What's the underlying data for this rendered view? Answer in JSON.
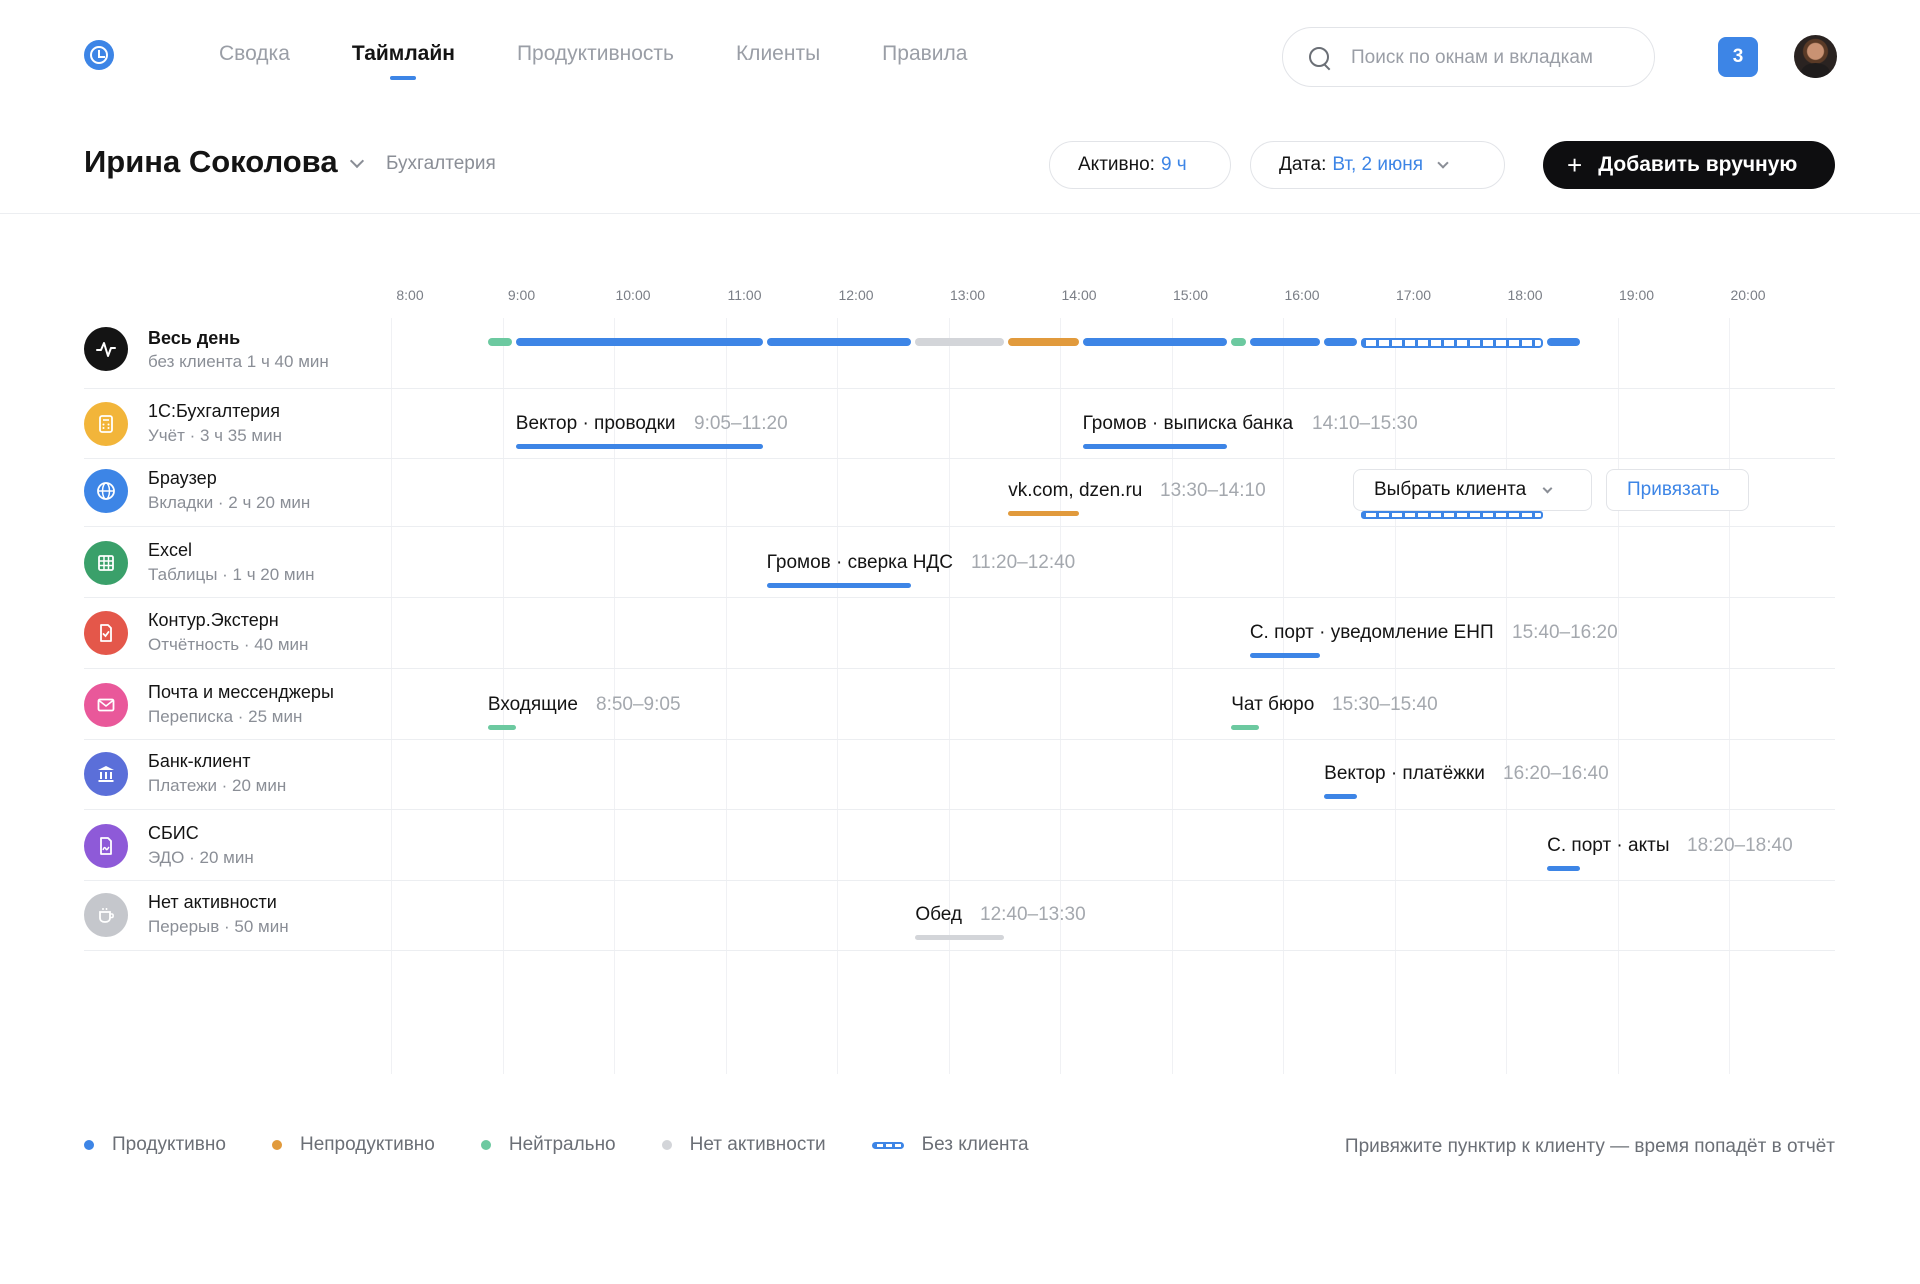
{
  "nav": {
    "items": [
      {
        "label": "Сводка",
        "active": false
      },
      {
        "label": "Таймлайн",
        "active": true
      },
      {
        "label": "Продуктивность",
        "active": false
      },
      {
        "label": "Клиенты",
        "active": false
      },
      {
        "label": "Правила",
        "active": false
      }
    ],
    "search_placeholder": "Поиск по окнам и вкладкам",
    "notifications": "3"
  },
  "header": {
    "person": "Ирина Соколова",
    "department": "Бухгалтерия",
    "active_label": "Активно:",
    "active_value": "9 ч",
    "date_label": "Дата:",
    "date_value": "Вт, 2 июня",
    "add_button": "Добавить вручную",
    "add_icon": "+"
  },
  "hours": [
    "8:00",
    "9:00",
    "10:00",
    "11:00",
    "12:00",
    "13:00",
    "14:00",
    "15:00",
    "16:00",
    "17:00",
    "18:00",
    "19:00",
    "20:00"
  ],
  "colors": {
    "productive": "#3d85e6",
    "unproductive": "#e19a3c",
    "neutral": "#6cc9a0",
    "idle": "#d3d5d9"
  },
  "summary_row": {
    "title": "Весь день",
    "subtitle": "без клиента 1 ч 40 мин",
    "icon": "pulse-icon",
    "segments": [
      {
        "start": "8:50",
        "end": "9:05",
        "type": "neutral"
      },
      {
        "start": "9:05",
        "end": "11:20",
        "type": "productive"
      },
      {
        "start": "11:20",
        "end": "12:40",
        "type": "productive"
      },
      {
        "start": "12:40",
        "end": "13:30",
        "type": "idle"
      },
      {
        "start": "13:30",
        "end": "14:10",
        "type": "unproductive"
      },
      {
        "start": "14:10",
        "end": "15:30",
        "type": "productive"
      },
      {
        "start": "15:30",
        "end": "15:40",
        "type": "neutral"
      },
      {
        "start": "15:40",
        "end": "16:20",
        "type": "productive"
      },
      {
        "start": "16:20",
        "end": "16:40",
        "type": "productive"
      },
      {
        "start": "16:40",
        "end": "18:20",
        "type": "no-client"
      },
      {
        "start": "18:20",
        "end": "18:40",
        "type": "productive"
      }
    ]
  },
  "apps": [
    {
      "title": "1С:Бухгалтерия",
      "subtitle": "Учёт · 3 ч 35 мин",
      "icon": "calculator-icon",
      "color": "#f2b53a",
      "segments": [
        {
          "label": "Вектор · проводки",
          "time": "9:05–11:20",
          "start": "9:05",
          "end": "11:20",
          "type": "productive"
        },
        {
          "label": "Громов · выписка банка",
          "time": "14:10–15:30",
          "start": "14:10",
          "end": "15:30",
          "type": "productive"
        }
      ]
    },
    {
      "title": "Браузер",
      "subtitle": "Вкладки · 2 ч 20 мин",
      "icon": "globe-icon",
      "color": "#3d85e6",
      "segments": [
        {
          "label": "vk.com, dzen.ru",
          "time": "13:30–14:10",
          "start": "13:30",
          "end": "14:10",
          "type": "unproductive"
        },
        {
          "label": "",
          "time": "",
          "start": "16:40",
          "end": "18:20",
          "type": "no-client"
        }
      ],
      "select_label": "Выбрать клиента",
      "link_label": "Привязать"
    },
    {
      "title": "Excel",
      "subtitle": "Таблицы · 1 ч 20 мин",
      "icon": "table-icon",
      "color": "#3aa06a",
      "segments": [
        {
          "label": "Громов · сверка НДС",
          "time": "11:20–12:40",
          "start": "11:20",
          "end": "12:40",
          "type": "productive"
        }
      ]
    },
    {
      "title": "Контур.Экстерн",
      "subtitle": "Отчётность · 40 мин",
      "icon": "document-check-icon",
      "color": "#e4574a",
      "segments": [
        {
          "label": "С. порт · уведомление ЕНП",
          "time": "15:40–16:20",
          "start": "15:40",
          "end": "16:20",
          "type": "productive"
        }
      ]
    },
    {
      "title": "Почта и мессенджеры",
      "subtitle": "Переписка · 25 мин",
      "icon": "mail-icon",
      "color": "#e9589a",
      "segments": [
        {
          "label": "Входящие",
          "time": "8:50–9:05",
          "start": "8:50",
          "end": "9:05",
          "type": "neutral"
        },
        {
          "label": "Чат бюро",
          "time": "15:30–15:40",
          "start": "15:30",
          "end": "15:40",
          "type": "neutral"
        }
      ]
    },
    {
      "title": "Банк-клиент",
      "subtitle": "Платежи · 20 мин",
      "icon": "bank-icon",
      "color": "#5b6fd9",
      "segments": [
        {
          "label": "Вектор · платёжки",
          "time": "16:20–16:40",
          "start": "16:20",
          "end": "16:40",
          "type": "productive"
        }
      ]
    },
    {
      "title": "СБИС",
      "subtitle": "ЭДО · 20 мин",
      "icon": "signed-document-icon",
      "color": "#8e5ad8",
      "segments": [
        {
          "label": "С. порт · акты",
          "time": "18:20–18:40",
          "start": "18:20",
          "end": "18:40",
          "type": "productive"
        }
      ]
    },
    {
      "title": "Нет активности",
      "subtitle": "Перерыв · 50 мин",
      "icon": "coffee-cup-icon",
      "color": "#c5c7cc",
      "segments": [
        {
          "label": "Обед",
          "time": "12:40–13:30",
          "start": "12:40",
          "end": "13:30",
          "type": "idle"
        }
      ]
    }
  ],
  "legend": [
    {
      "label": "Продуктивно",
      "type": "productive"
    },
    {
      "label": "Непродуктивно",
      "type": "unproductive"
    },
    {
      "label": "Нейтрально",
      "type": "neutral"
    },
    {
      "label": "Нет активности",
      "type": "idle"
    },
    {
      "label": "Без клиента",
      "type": "no-client"
    }
  ],
  "hint": "Привяжите пунктир к клиенту — время попадёт в отчёт"
}
